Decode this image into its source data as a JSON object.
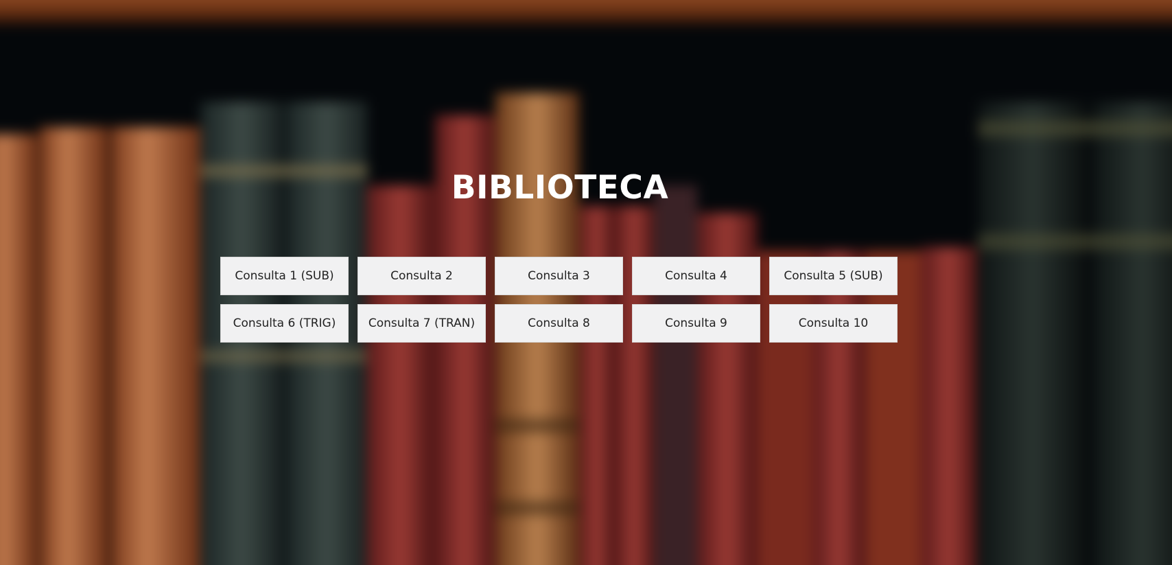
{
  "page": {
    "title": "BIBLIOTECA"
  },
  "buttons": [
    "Consulta 1 (SUB)",
    "Consulta 2",
    "Consulta 3",
    "Consulta 4",
    "Consulta 5 (SUB)",
    "Consulta 6 (TRIG)",
    "Consulta 7 (TRAN)",
    "Consulta 8",
    "Consulta 9",
    "Consulta 10"
  ],
  "colors": {
    "title_text": "#ffffff",
    "button_background": "#f1f1f2",
    "button_text": "#222222",
    "shelf_wood": "#8a4a25",
    "background_dark": "#05080a"
  }
}
